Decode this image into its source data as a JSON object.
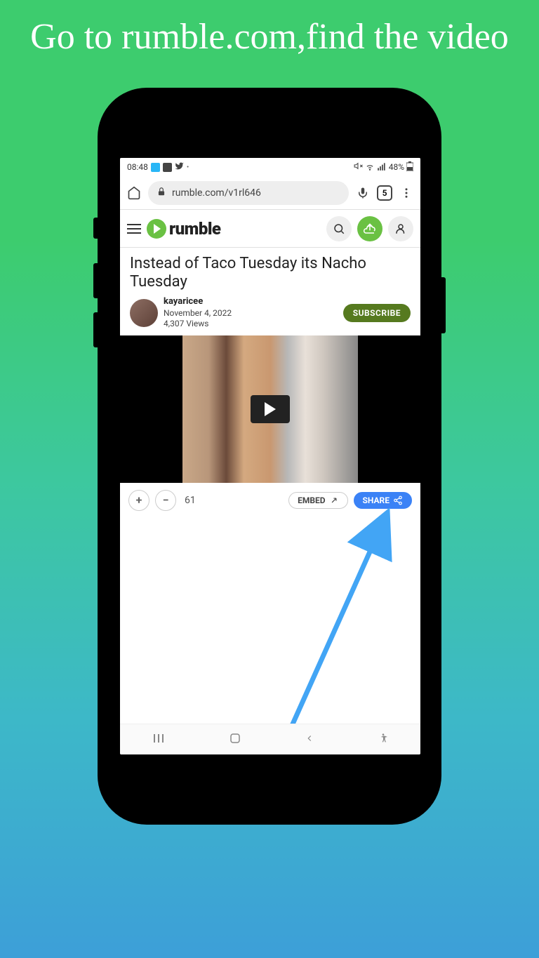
{
  "instruction": "Go to rumble.com,find the video",
  "status": {
    "time": "08:48",
    "battery": "48%"
  },
  "browser": {
    "url": "rumble.com/v1rl646",
    "tab_count": "5"
  },
  "site": {
    "brand": "rumble"
  },
  "video": {
    "title": "Instead of Taco Tuesday its Nacho Tuesday",
    "channel": "kayaricee",
    "date": "November 4, 2022",
    "views": "4,307 Views",
    "subscribe_label": "SUBSCRIBE"
  },
  "actions": {
    "votes": "61",
    "embed": "EMBED",
    "share": "SHARE"
  }
}
